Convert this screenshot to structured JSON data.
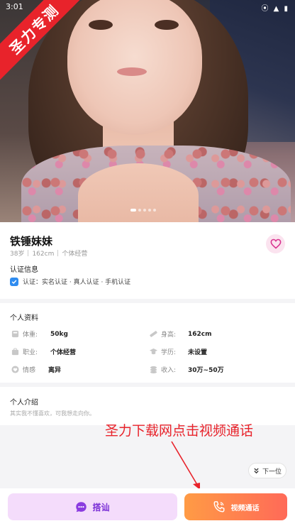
{
  "status_bar": {
    "time": "3:01",
    "icons": "⦿ ▲ ▮"
  },
  "watermark": {
    "text": "圣力专测"
  },
  "carousel": {
    "dot_count": 5,
    "active_index": 0
  },
  "profile": {
    "name": "铁锤妹妹",
    "age": "38岁",
    "height": "162cm",
    "job": "个体经营",
    "verify_title": "认证信息",
    "verify_text": "认证：实名认证 · 真人认证 · 手机认证"
  },
  "details": {
    "title": "个人资料",
    "weight_label": "体重:",
    "weight_value": "50kg",
    "height_label": "身高:",
    "height_value": "162cm",
    "job_label": "职业:",
    "job_value": "个体经营",
    "edu_label": "学历:",
    "edu_value": "未设置",
    "marital_label": "情感",
    "marital_value": "离异",
    "income_label": "收入:",
    "income_value": "30万~50万"
  },
  "intro": {
    "title": "个人介绍",
    "text": "其实我不懂喜欢，可我想走向你。"
  },
  "annotation": {
    "text": "圣力下载网点击视频通话"
  },
  "next_button": {
    "label": "下一位"
  },
  "actions": {
    "chat_label": "搭讪",
    "call_label": "视频通话"
  },
  "colors": {
    "accent_purple": "#7a2fd6",
    "call_orange": "#ff7a52",
    "watermark_red": "#e8232b",
    "verified_blue": "#2f8cf0"
  }
}
